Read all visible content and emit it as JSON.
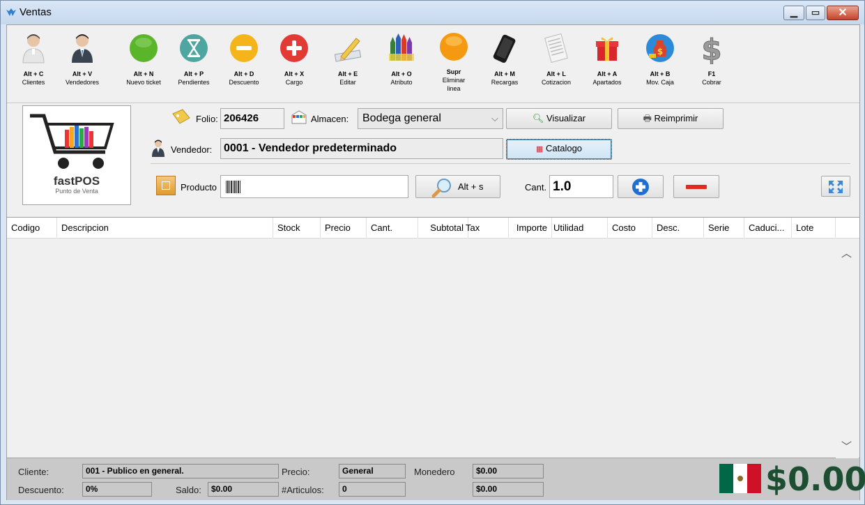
{
  "window": {
    "title": "Ventas"
  },
  "toolbar": [
    {
      "key": "Alt + C",
      "label": "Clientes",
      "icon": "client-person-icon"
    },
    {
      "key": "Alt + V",
      "label": "Vendedores",
      "icon": "seller-person-icon"
    },
    {
      "key": "Alt + N",
      "label": "Nuevo ticket",
      "icon": "green-circle-icon"
    },
    {
      "key": "Alt + P",
      "label": "Pendientes",
      "icon": "hourglass-icon"
    },
    {
      "key": "Alt + D",
      "label": "Descuento",
      "icon": "minus-circle-icon"
    },
    {
      "key": "Alt + X",
      "label": "Cargo",
      "icon": "plus-circle-icon"
    },
    {
      "key": "Alt + E",
      "label": "Editar",
      "icon": "pencil-ruler-icon"
    },
    {
      "key": "Alt + O",
      "label": "Atributo",
      "icon": "crayons-icon"
    },
    {
      "key": "Supr",
      "label": "Eliminar linea",
      "icon": "orange-circle-icon"
    },
    {
      "key": "Alt + M",
      "label": "Recargas",
      "icon": "phone-icon"
    },
    {
      "key": "Alt + L",
      "label": "Cotizacion",
      "icon": "receipt-icon"
    },
    {
      "key": "Alt + A",
      "label": "Apartados",
      "icon": "gift-icon"
    },
    {
      "key": "Alt + B",
      "label": "Mov. Caja",
      "icon": "money-bag-icon"
    },
    {
      "key": "F1",
      "label": "Cobrar",
      "icon": "dollar-sign-icon"
    }
  ],
  "logo": {
    "name": "fastPOS",
    "subtitle": "Punto de Venta"
  },
  "form": {
    "folio_label": "Folio:",
    "folio_value": "206426",
    "almacen_label": "Almacen:",
    "almacen_value": "Bodega general",
    "visualizar": "Visualizar",
    "reimprimir": "Reimprimir",
    "vendedor_label": "Vendedor:",
    "vendedor_value": "0001 - Vendedor predeterminado",
    "catalogo": "Catalogo",
    "producto_label": "Producto",
    "producto_value": "",
    "search_shortcut": "Alt + s",
    "cant_label": "Cant.",
    "cant_value": "1.0"
  },
  "table": {
    "columns": [
      "Codigo",
      "Descripcion",
      "Stock",
      "Precio",
      "Cant.",
      "Subtotal",
      "Tax",
      "Importe",
      "Utilidad",
      "Costo",
      "Desc.",
      "Serie",
      "Caduci...",
      "Lote"
    ],
    "rows": []
  },
  "footer": {
    "cliente_label": "Cliente:",
    "cliente_value": "001 - Publico en general.",
    "precio_label": "Precio:",
    "precio_value": "General",
    "monedero_label": "Monedero",
    "monedero_value": "$0.00",
    "descuento_label": "Descuento:",
    "descuento_value": "0%",
    "saldo_label": "Saldo:",
    "saldo_value": "$0.00",
    "articulos_label": "#Articulos:",
    "articulos_value": "0",
    "extra_value": "$0.00",
    "total": "$0.00"
  },
  "colors": {
    "total": "#1e4e32",
    "footer_bg": "#c9c9c9"
  }
}
